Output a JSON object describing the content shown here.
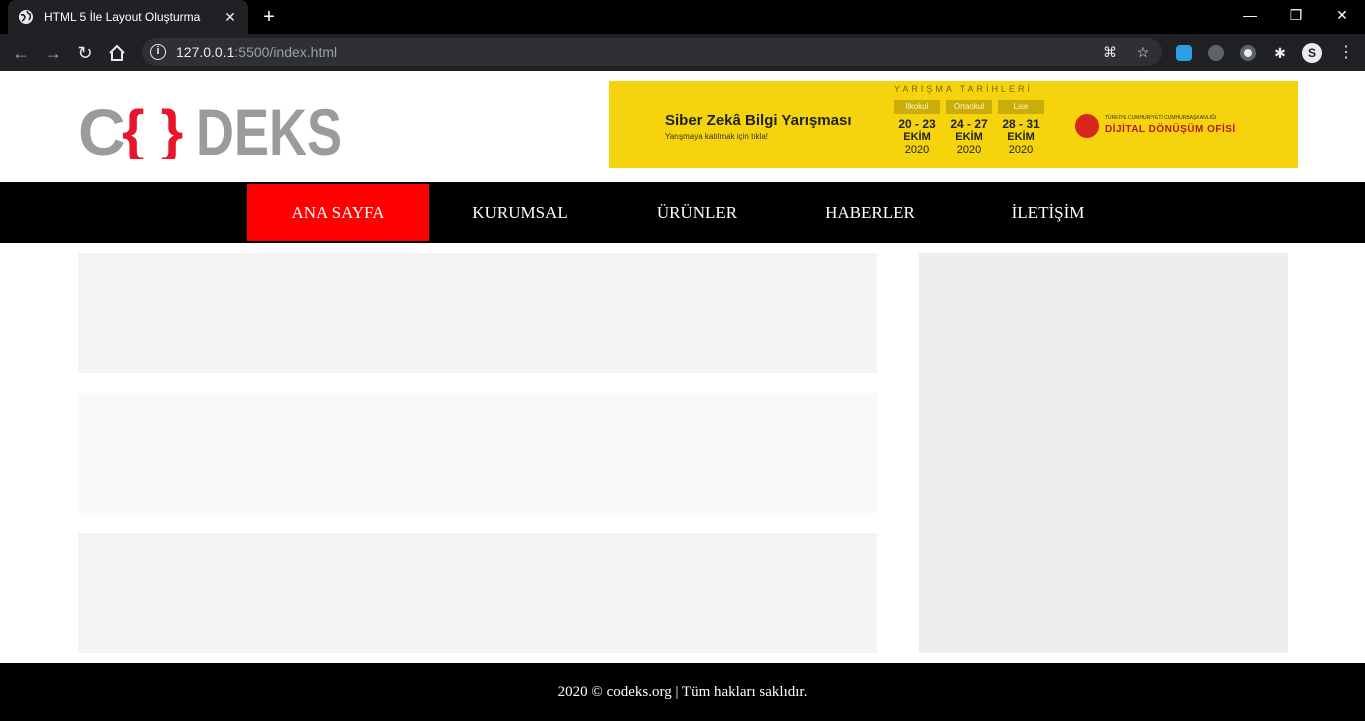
{
  "browser": {
    "tab_title": "HTML 5 İle Layout Oluşturma",
    "tab_close": "✕",
    "new_tab": "+",
    "url_host": "127.0.0.1",
    "url_path": ":5500/index.html",
    "window_minimize": "—",
    "window_restore": "❐",
    "window_close": "✕"
  },
  "header": {
    "banner": {
      "title": "Siber Zekâ Bilgi Yarışması",
      "subtitle": "Yarışmaya katılmak için tıkla!",
      "heading": "YARIŞMA TARİHLERİ",
      "columns": [
        {
          "level": "İlkokul",
          "dates": "20 - 23",
          "month": "EKİM",
          "year": "2020"
        },
        {
          "level": "Ortaokul",
          "dates": "24 - 27",
          "month": "EKİM",
          "year": "2020"
        },
        {
          "level": "Lise",
          "dates": "28 - 31",
          "month": "EKİM",
          "year": "2020"
        }
      ],
      "org_small": "TÜRKİYE CUMHURİYETİ CUMHURBAŞKANLIĞI",
      "org": "DİJİTAL DÖNÜŞÜM OFİSİ"
    },
    "logo_text": "CODEKS"
  },
  "nav": {
    "items": [
      "ANA SAYFA",
      "KURUMSAL",
      "ÜRÜNLER",
      "HABERLER",
      "İLETİŞİM"
    ]
  },
  "colors": {
    "nav_active": "#ff0000",
    "banner_bg": "#f5d40d",
    "block1": "#f4f4f4",
    "block2": "#f9f9f9",
    "block3": "#f4f4f4",
    "sidebar": "#eeeeee"
  },
  "footer": {
    "text": "2020 © codeks.org | Tüm hakları saklıdır."
  }
}
